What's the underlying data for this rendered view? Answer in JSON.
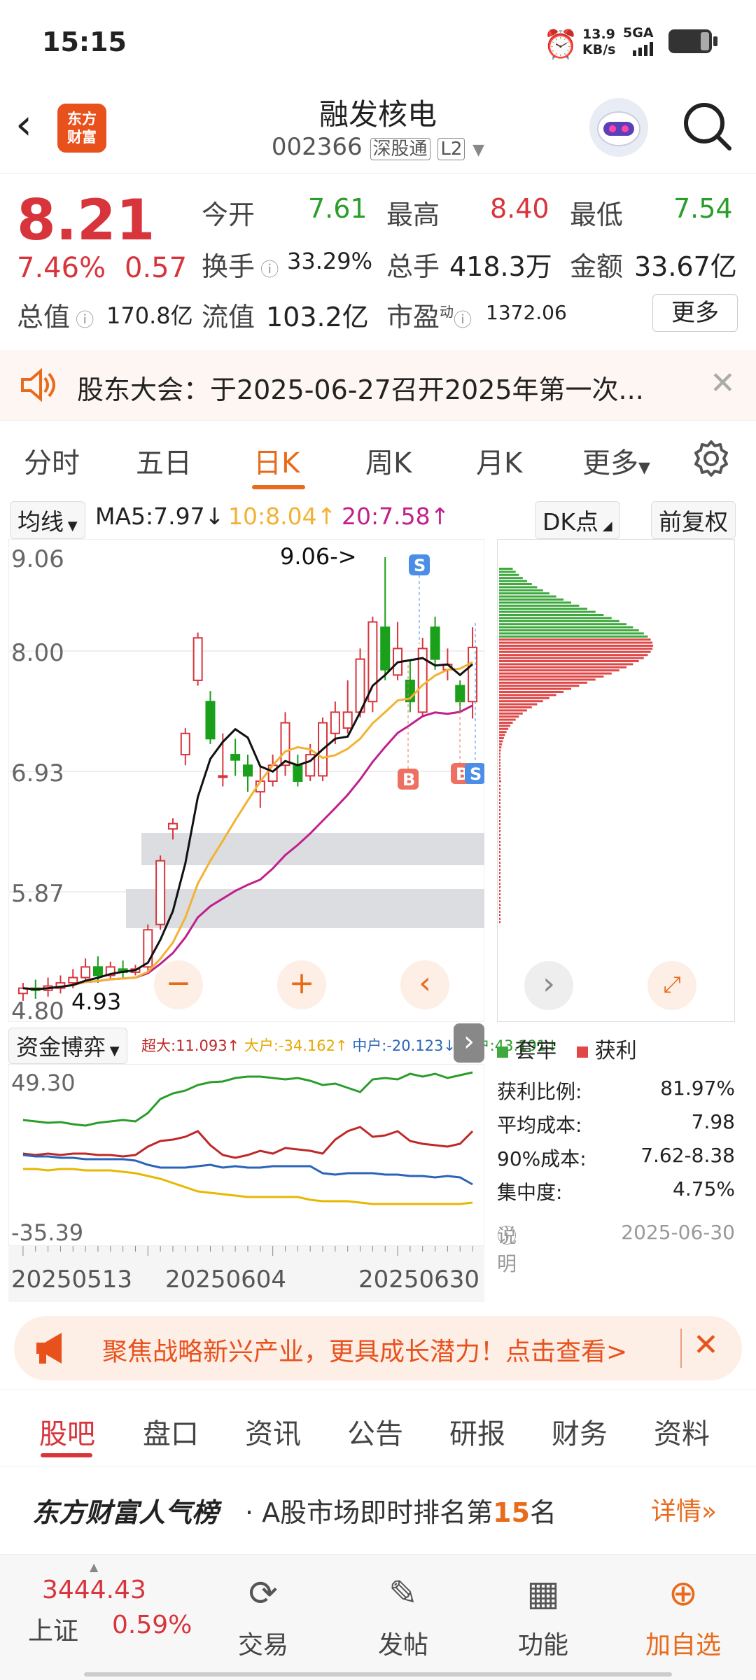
{
  "status": {
    "time": "15:15",
    "speed_value": "13.9",
    "speed_unit": "KB/s",
    "network": "5GA"
  },
  "header": {
    "logo_text": "东方\n财富",
    "title": "融发核电",
    "code": "002366",
    "tag": "深股通",
    "level": "L2"
  },
  "quote": {
    "price": "8.21",
    "pct": "7.46%",
    "chg": "0.57",
    "open_label": "今开",
    "open": "7.61",
    "high_label": "最高",
    "high": "8.40",
    "low_label": "最低",
    "low": "7.54",
    "turnover_label": "换手",
    "turnover": "33.29%",
    "volume_label": "总手",
    "volume": "418.3万",
    "amount_label": "金额",
    "amount": "33.67亿",
    "mktcap_label": "总值",
    "mktcap": "170.8亿",
    "float_label": "流值",
    "float": "103.2亿",
    "pe_label": "市盈",
    "pe_sup": "动",
    "pe": "1372.06",
    "more": "更多"
  },
  "notice": {
    "text": "股东大会：于2025-06-27召开2025年第一次..."
  },
  "tabs": [
    "分时",
    "五日",
    "日K",
    "周K",
    "月K",
    "更多"
  ],
  "active_tab": "日K",
  "ma": {
    "label": "均线",
    "ma5": "MA5:7.97",
    "ma5_arrow": "↓",
    "ma10": "10:8.04",
    "ma10_arrow": "↑",
    "ma20": "20:7.58",
    "ma20_arrow": "↑",
    "dk": "DK点",
    "adj": "前复权"
  },
  "kchart": {
    "y_labels": [
      "9.06",
      "8.00",
      "6.93",
      "5.87",
      "4.80"
    ],
    "max_note": "9.06->",
    "min_note": "4.93",
    "colors": {
      "up": "#d8343c",
      "down": "#1aa01a",
      "ma5": "#111111",
      "ma10": "#f2b234",
      "ma20": "#c0208c"
    }
  },
  "indicator": {
    "label": "资金博弈",
    "items": [
      "超大:11.093↑",
      "大户:-34.162↑",
      "中户:-20.123↓",
      "小户:43.191↓"
    ],
    "top": "49.30",
    "bottom": "-35.39"
  },
  "dates": [
    "20250513",
    "20250604",
    "20250630"
  ],
  "chips": {
    "legend_trap": "套牢",
    "legend_profit": "获利",
    "rows": [
      {
        "k": "获利比例:",
        "v": "81.97%"
      },
      {
        "k": "平均成本:",
        "v": "7.98"
      },
      {
        "k": "90%成本:",
        "v": "7.62-8.38"
      },
      {
        "k": "集中度:",
        "v": "4.75%"
      }
    ],
    "note": "说明",
    "date": "2025-06-30"
  },
  "ad": {
    "text": "聚焦战略新兴产业，更具成长潜力！点击查看>"
  },
  "tabs2": [
    "股吧",
    "盘口",
    "资讯",
    "公告",
    "研报",
    "财务",
    "资料"
  ],
  "rank": {
    "title": "东方财富人气榜",
    "text_a": "· A股市场即时排名第",
    "num": "15",
    "text_b": "名",
    "detail": "详情"
  },
  "bottom": {
    "index_value": "3444.43",
    "index_name": "上证",
    "index_pct": "0.59%",
    "items": [
      "交易",
      "发帖",
      "功能",
      "加自选"
    ]
  }
}
